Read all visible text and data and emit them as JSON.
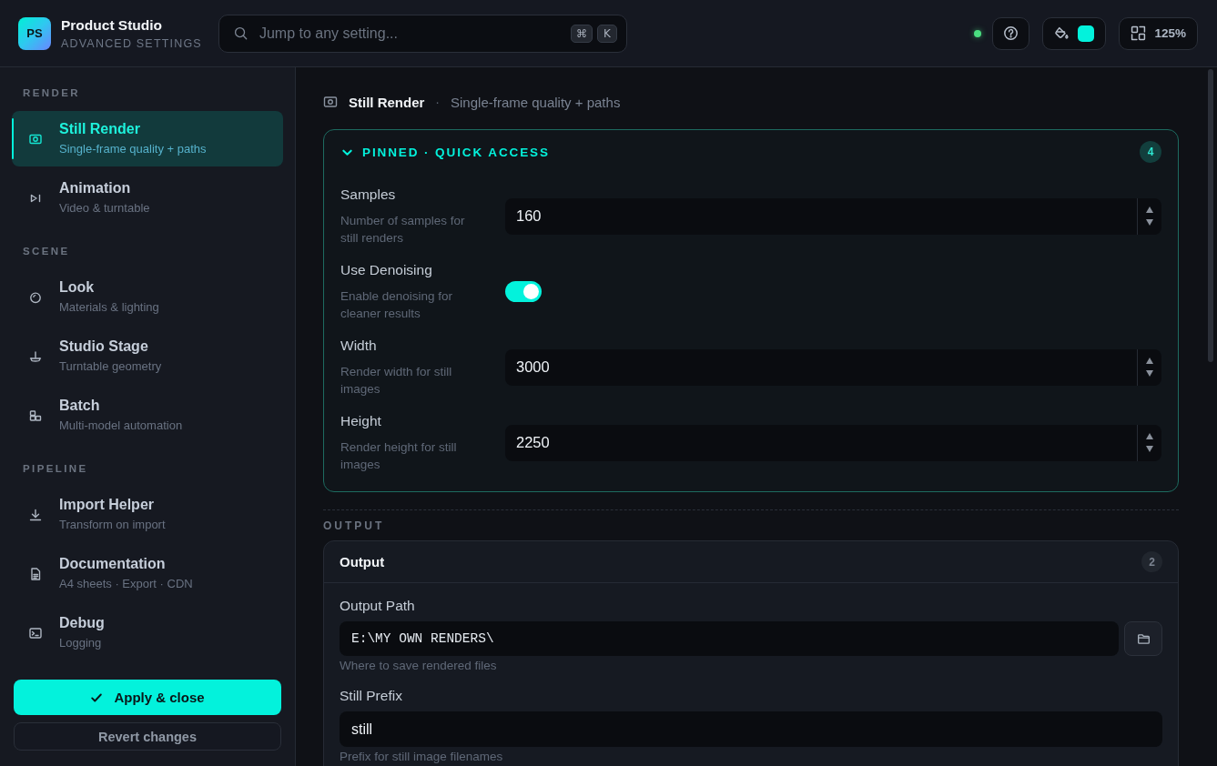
{
  "header": {
    "logo": "PS",
    "title": "Product Studio",
    "subtitle": "ADVANCED SETTINGS",
    "search": {
      "placeholder": "Jump to any setting...",
      "keys": [
        "⌘",
        "K"
      ]
    },
    "status": {
      "on": true
    },
    "zoom": "125%"
  },
  "sidebar": {
    "sections": [
      {
        "label": "RENDER",
        "items": [
          {
            "title": "Still Render",
            "subtitle": "Single-frame quality + paths",
            "selected": true
          },
          {
            "title": "Animation",
            "subtitle": "Video & turntable",
            "selected": false
          }
        ]
      },
      {
        "label": "SCENE",
        "items": [
          {
            "title": "Look",
            "subtitle": "Materials & lighting",
            "selected": false
          },
          {
            "title": "Studio Stage",
            "subtitle": "Turntable geometry",
            "selected": false
          },
          {
            "title": "Batch",
            "subtitle": "Multi-model automation",
            "selected": false
          }
        ]
      },
      {
        "label": "PIPELINE",
        "items": [
          {
            "title": "Import Helper",
            "subtitle": "Transform on import",
            "selected": false
          },
          {
            "title": "Documentation",
            "subtitle": "A4 sheets · Export · CDN",
            "selected": false
          },
          {
            "title": "Debug",
            "subtitle": "Logging",
            "selected": false
          }
        ]
      }
    ],
    "actions": [
      {
        "kind": "primary",
        "label": "Apply & close"
      },
      {
        "kind": "secondary",
        "label": "Revert changes"
      }
    ]
  },
  "main": {
    "breadcrumb": {
      "title": "Still Render",
      "separator": "·",
      "subtitle": "Single-frame quality + paths"
    },
    "pinned": {
      "title": "PINNED · QUICK ACCESS",
      "count": "4",
      "expanded": true,
      "fields": [
        {
          "kind": "number",
          "label": "Samples",
          "description": "Number of samples for still renders",
          "value": "160"
        },
        {
          "kind": "toggle",
          "label": "Use Denoising",
          "description": "Enable denoising for cleaner results",
          "on": true
        },
        {
          "kind": "number",
          "label": "Width",
          "description": "Render width for still images",
          "value": "3000"
        },
        {
          "kind": "number",
          "label": "Height",
          "description": "Render height for still images",
          "value": "2250"
        }
      ]
    },
    "sections": [
      {
        "label": "OUTPUT",
        "title": "Output",
        "count": "2",
        "fields": [
          {
            "kind": "path",
            "label": "Output Path",
            "value": "E:\\MY OWN RENDERS\\",
            "hint": "Where to save rendered files"
          },
          {
            "kind": "text",
            "label": "Still Prefix",
            "value": "still",
            "hint": "Prefix for still image filenames"
          }
        ]
      }
    ]
  }
}
